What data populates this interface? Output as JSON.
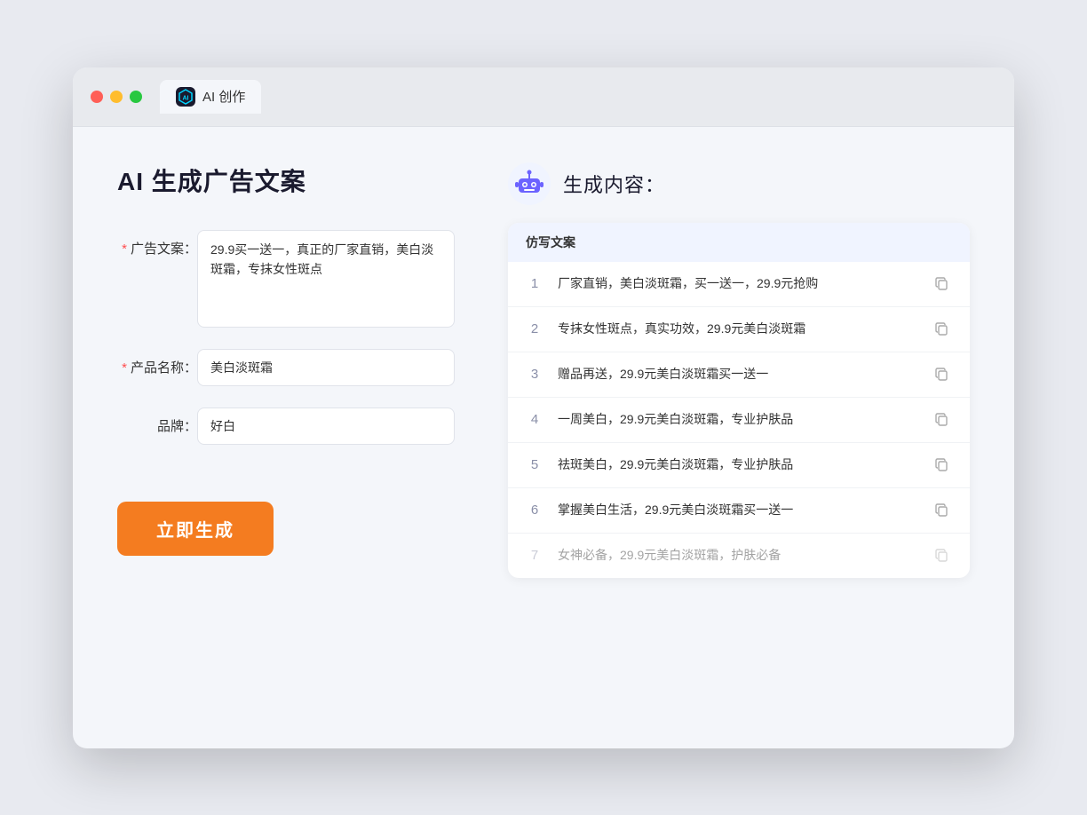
{
  "browser": {
    "tab_label": "AI 创作",
    "tab_icon_text": "AI"
  },
  "left": {
    "page_title": "AI 生成广告文案",
    "fields": {
      "ad_copy_label": "广告文案：",
      "ad_copy_required": "*",
      "ad_copy_value": "29.9买一送一，真正的厂家直销，美白淡斑霜，专抹女性斑点",
      "product_name_label": "产品名称：",
      "product_name_required": "*",
      "product_name_value": "美白淡斑霜",
      "brand_label": "品牌：",
      "brand_value": "好白"
    },
    "generate_button": "立即生成"
  },
  "right": {
    "result_title": "生成内容：",
    "table_header": "仿写文案",
    "rows": [
      {
        "num": "1",
        "text": "厂家直销，美白淡斑霜，买一送一，29.9元抢购",
        "faded": false
      },
      {
        "num": "2",
        "text": "专抹女性斑点，真实功效，29.9元美白淡斑霜",
        "faded": false
      },
      {
        "num": "3",
        "text": "赠品再送，29.9元美白淡斑霜买一送一",
        "faded": false
      },
      {
        "num": "4",
        "text": "一周美白，29.9元美白淡斑霜，专业护肤品",
        "faded": false
      },
      {
        "num": "5",
        "text": "祛斑美白，29.9元美白淡斑霜，专业护肤品",
        "faded": false
      },
      {
        "num": "6",
        "text": "掌握美白生活，29.9元美白淡斑霜买一送一",
        "faded": false
      },
      {
        "num": "7",
        "text": "女神必备，29.9元美白淡斑霜，护肤必备",
        "faded": true
      }
    ]
  }
}
